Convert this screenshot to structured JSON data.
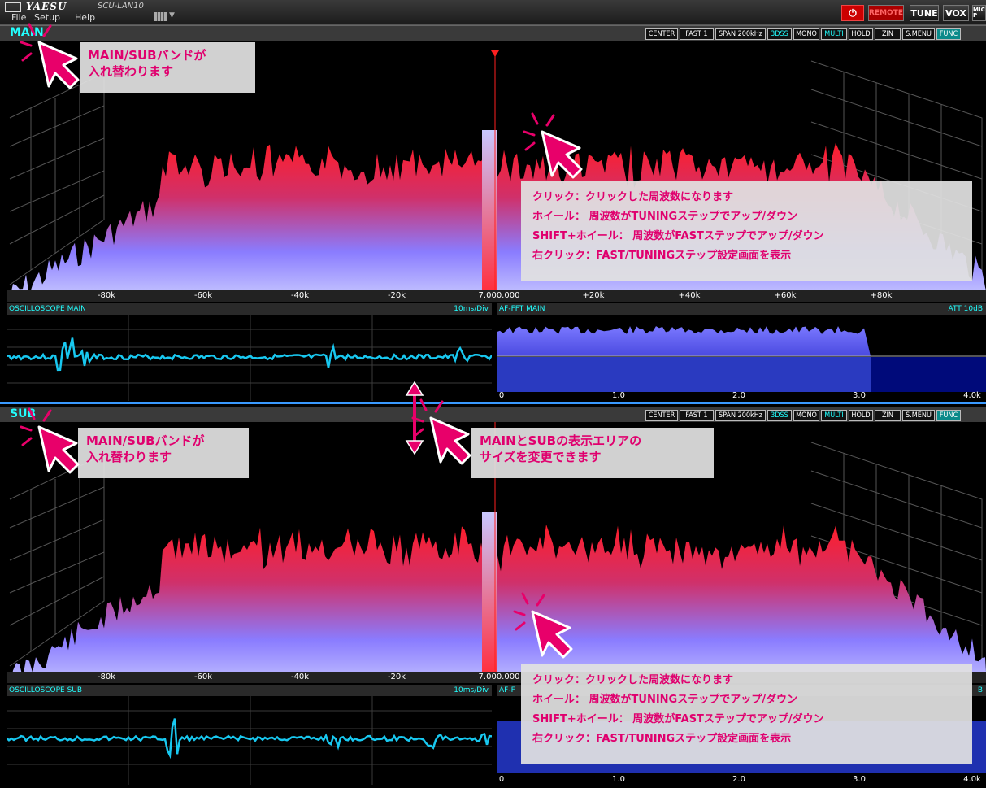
{
  "app": {
    "brand": "YAESU",
    "model": "SCU-LAN10"
  },
  "menu": [
    "File",
    "Setup",
    "Help"
  ],
  "header_buttons": {
    "remote": "REMOTE",
    "tune": "TUNE",
    "vox": "VOX",
    "mic": "MIC P"
  },
  "colors": {
    "accent": "#00e5ff",
    "callout_text": "#e0006e",
    "spectrum_top": "#ff2030",
    "spectrum_base": "#8080ff"
  },
  "main": {
    "label": "MAIN",
    "controls": [
      "CENTER",
      "FAST 1",
      "SPAN 200kHz",
      "3DSS",
      "MONO",
      "MULTI",
      "HOLD",
      "ZIN",
      "S.MENU",
      "FUNC"
    ],
    "freq_ticks": [
      "-80k",
      "-60k",
      "-40k",
      "-20k",
      "7.000.000",
      "+20k",
      "+40k",
      "+60k",
      "+80k"
    ],
    "oscilloscope_title": "OSCILLOSCOPE MAIN",
    "oscilloscope_scale": "10ms/Div",
    "affft_title": "AF-FFT MAIN",
    "affft_att": "ATT  10dB",
    "affft_ticks": [
      "0",
      "1.0",
      "2.0",
      "3.0",
      "4.0k"
    ]
  },
  "sub": {
    "label": "SUB",
    "controls": [
      "CENTER",
      "FAST 1",
      "SPAN 200kHz",
      "3DSS",
      "MONO",
      "MULTI",
      "HOLD",
      "ZIN",
      "S.MENU",
      "FUNC"
    ],
    "freq_ticks": [
      "-80k",
      "-60k",
      "-40k",
      "-20k",
      "7.000.000"
    ],
    "oscilloscope_title": "OSCILLOSCOPE SUB",
    "oscilloscope_scale": "10ms/Div",
    "affft_title": "AF-F",
    "affft_right": "B",
    "affft_ticks": [
      "0",
      "1.0",
      "2.0",
      "3.0",
      "4.0k"
    ]
  },
  "callouts": {
    "swap_main": [
      "MAIN/SUBバンドが",
      "入れ替わります"
    ],
    "swap_sub": [
      "MAIN/SUBバンドが",
      "入れ替わります"
    ],
    "resize": [
      "MAINとSUBの表示エリアの",
      "サイズを変更できます"
    ],
    "ops_main": [
      "クリック：クリックした周波数になります",
      "ホイール： 周波数がTUNINGステップでアップ/ダウン",
      "SHIFT+ホイール： 周波数がFASTステップでアップ/ダウン",
      "右クリック：FAST/TUNINGステップ設定画面を表示"
    ],
    "ops_sub": [
      "クリック：クリックした周波数になります",
      "ホイール： 周波数がTUNINGステップでアップ/ダウン",
      "SHIFT+ホイール： 周波数がFASTステップでアップ/ダウン",
      "右クリック：FAST/TUNINGステップ設定画面を表示"
    ]
  }
}
